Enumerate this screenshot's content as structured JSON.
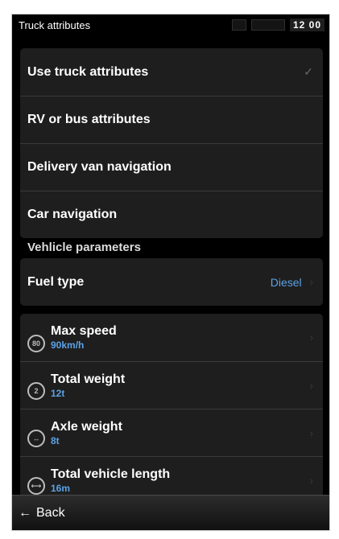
{
  "status": {
    "title": "Truck attributes",
    "clock": "12 00",
    "icons": [
      "mic-icon",
      "signal-icon"
    ]
  },
  "profiles": [
    {
      "label": "Use truck attributes",
      "selected": true,
      "check": "✓"
    },
    {
      "label": "RV or bus attributes",
      "selected": false
    },
    {
      "label": "Delivery van navigation",
      "selected": false
    },
    {
      "label": "Car navigation",
      "selected": false
    }
  ],
  "section_title": "Vehlicle parameters",
  "fuel": {
    "label": "Fuel type",
    "value": "Diesel"
  },
  "params": [
    {
      "label": "Max speed",
      "value": "90km/h",
      "icon": "speed-limit-icon",
      "icon_text": "80"
    },
    {
      "label": "Total weight",
      "value": "12t",
      "icon": "weight-icon",
      "icon_text": "2"
    },
    {
      "label": "Axle weight",
      "value": "8t",
      "icon": "axle-icon",
      "icon_text": "↔"
    },
    {
      "label": "Total vehicle length",
      "value": "16m",
      "icon": "length-icon",
      "icon_text": "⟷"
    }
  ],
  "footer": {
    "back_label": "Back"
  },
  "colors": {
    "accent": "#5ba2e6",
    "panel": "#1e1e1e",
    "background": "#000000"
  }
}
